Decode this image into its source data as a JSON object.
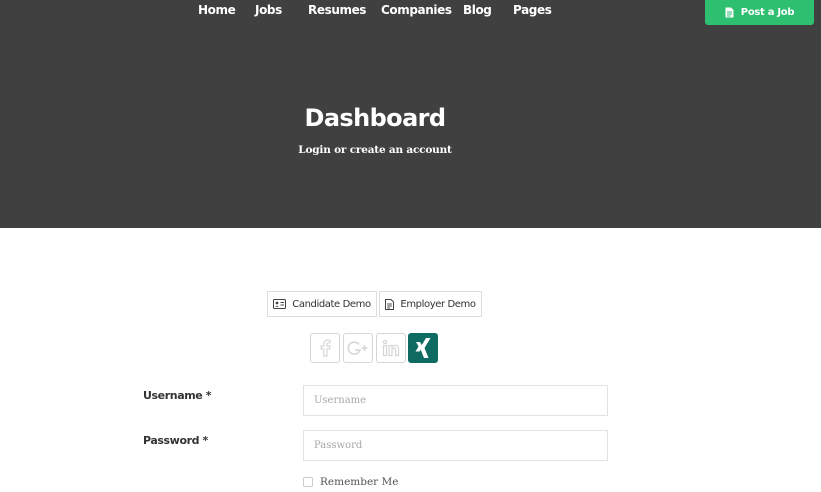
{
  "nav": {
    "items": [
      {
        "label": "Home"
      },
      {
        "label": "Jobs"
      },
      {
        "label": "Resumes"
      },
      {
        "label": "Companies"
      },
      {
        "label": "Blog"
      },
      {
        "label": "Pages"
      }
    ],
    "post_job_label": "Post a Job",
    "post_job_icon": "document-icon"
  },
  "hero": {
    "title": "Dashboard",
    "subtitle": "Login or create an account"
  },
  "demo": {
    "candidate_label": "Candidate Demo",
    "candidate_icon": "id-card-icon",
    "employer_label": "Employer Demo",
    "employer_icon": "document-icon"
  },
  "social": [
    {
      "icon": "facebook-icon",
      "state": "inactive"
    },
    {
      "icon": "google-plus-icon",
      "state": "inactive"
    },
    {
      "icon": "linkedin-icon",
      "state": "inactive"
    },
    {
      "icon": "xing-icon",
      "state": "active"
    }
  ],
  "form": {
    "username_label": "Username *",
    "username_placeholder": "Username",
    "password_label": "Password *",
    "password_placeholder": "Password",
    "remember_label": "Remember Me"
  },
  "colors": {
    "hero_bg": "#404040",
    "accent_green": "#2fbf71",
    "xing_teal": "#0f6a62"
  }
}
